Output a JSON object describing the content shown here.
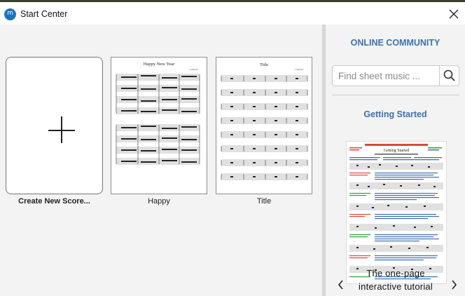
{
  "window": {
    "title": "Start Center",
    "colors": {
      "accent": "#3d70b0",
      "app_icon": "#1e73be"
    }
  },
  "icons": {
    "app": "musescore-logo-icon",
    "close": "close-icon",
    "search": "search-icon",
    "new": "plus-icon",
    "prev": "chevron-left-icon",
    "next": "chevron-right-icon"
  },
  "scores": [
    {
      "label": "Create New Score..."
    },
    {
      "label": "Happy",
      "thumb_title": "Happy New Year"
    },
    {
      "label": "Title",
      "thumb_title": "Title"
    }
  ],
  "sidebar": {
    "online_community": "ONLINE COMMUNITY",
    "search_placeholder": "Find sheet music ...",
    "getting_started": "Getting Started",
    "tutorial": {
      "thumb_title": "Getting Started",
      "caption_line1": "The one-page",
      "caption_line2": "interactive tutorial"
    }
  }
}
